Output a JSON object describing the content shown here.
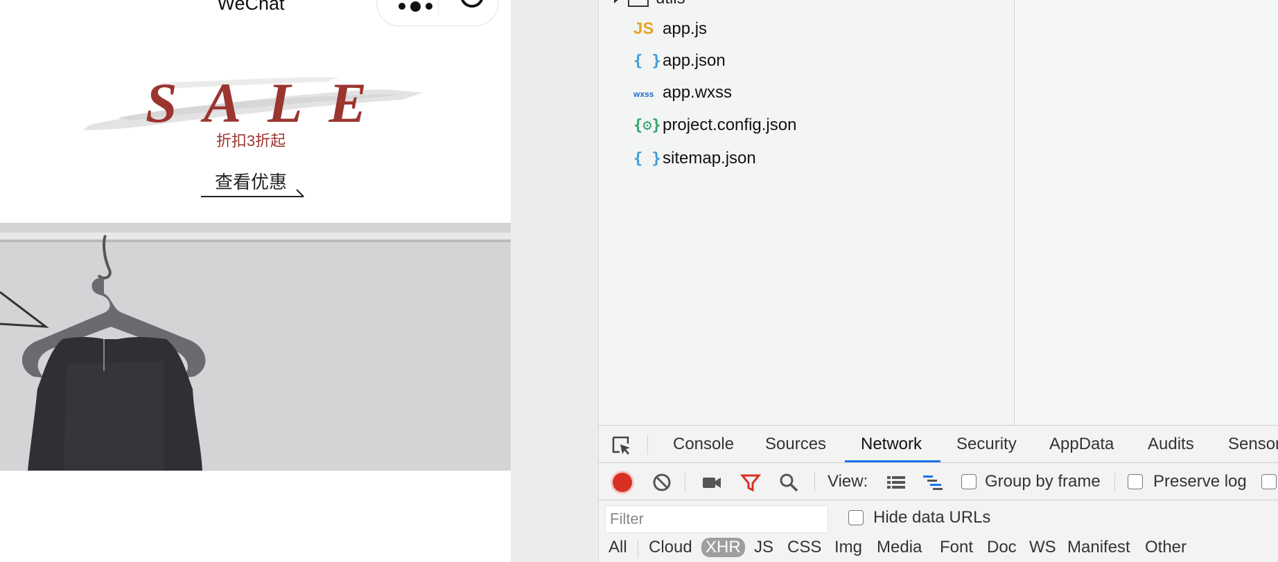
{
  "phone": {
    "nav_title": "WeChat",
    "sale_word": "SALE",
    "sale_subtitle": "折扣3折起",
    "view_deal": "查看优惠"
  },
  "file_tree": {
    "folder": "utils",
    "files": [
      {
        "icon": "JS",
        "icon_name": "js-file-icon",
        "name": "app.js"
      },
      {
        "icon": "{ }",
        "icon_name": "json-file-icon",
        "name": "app.json"
      },
      {
        "icon": "wxss",
        "icon_name": "wxss-file-icon",
        "name": "app.wxss"
      },
      {
        "icon": "{⚙}",
        "icon_name": "config-file-icon",
        "name": "project.config.json"
      },
      {
        "icon": "{ }",
        "icon_name": "json-file-icon",
        "name": "sitemap.json"
      }
    ]
  },
  "devtools": {
    "tabs": [
      "Console",
      "Sources",
      "Network",
      "Security",
      "AppData",
      "Audits",
      "Sensor"
    ],
    "active_tab": "Network",
    "toolbar": {
      "view_label": "View:",
      "group_by_frame": "Group by frame",
      "preserve_log": "Preserve log"
    },
    "filter": {
      "placeholder": "Filter",
      "hide_data_urls": "Hide data URLs"
    },
    "types": [
      "All",
      "Cloud",
      "XHR",
      "JS",
      "CSS",
      "Img",
      "Media",
      "Font",
      "Doc",
      "WS",
      "Manifest",
      "Other"
    ],
    "active_type": "XHR"
  },
  "colors": {
    "sale_red": "#9b3530",
    "accent_blue": "#1a73e8",
    "record_red": "#d93025"
  }
}
